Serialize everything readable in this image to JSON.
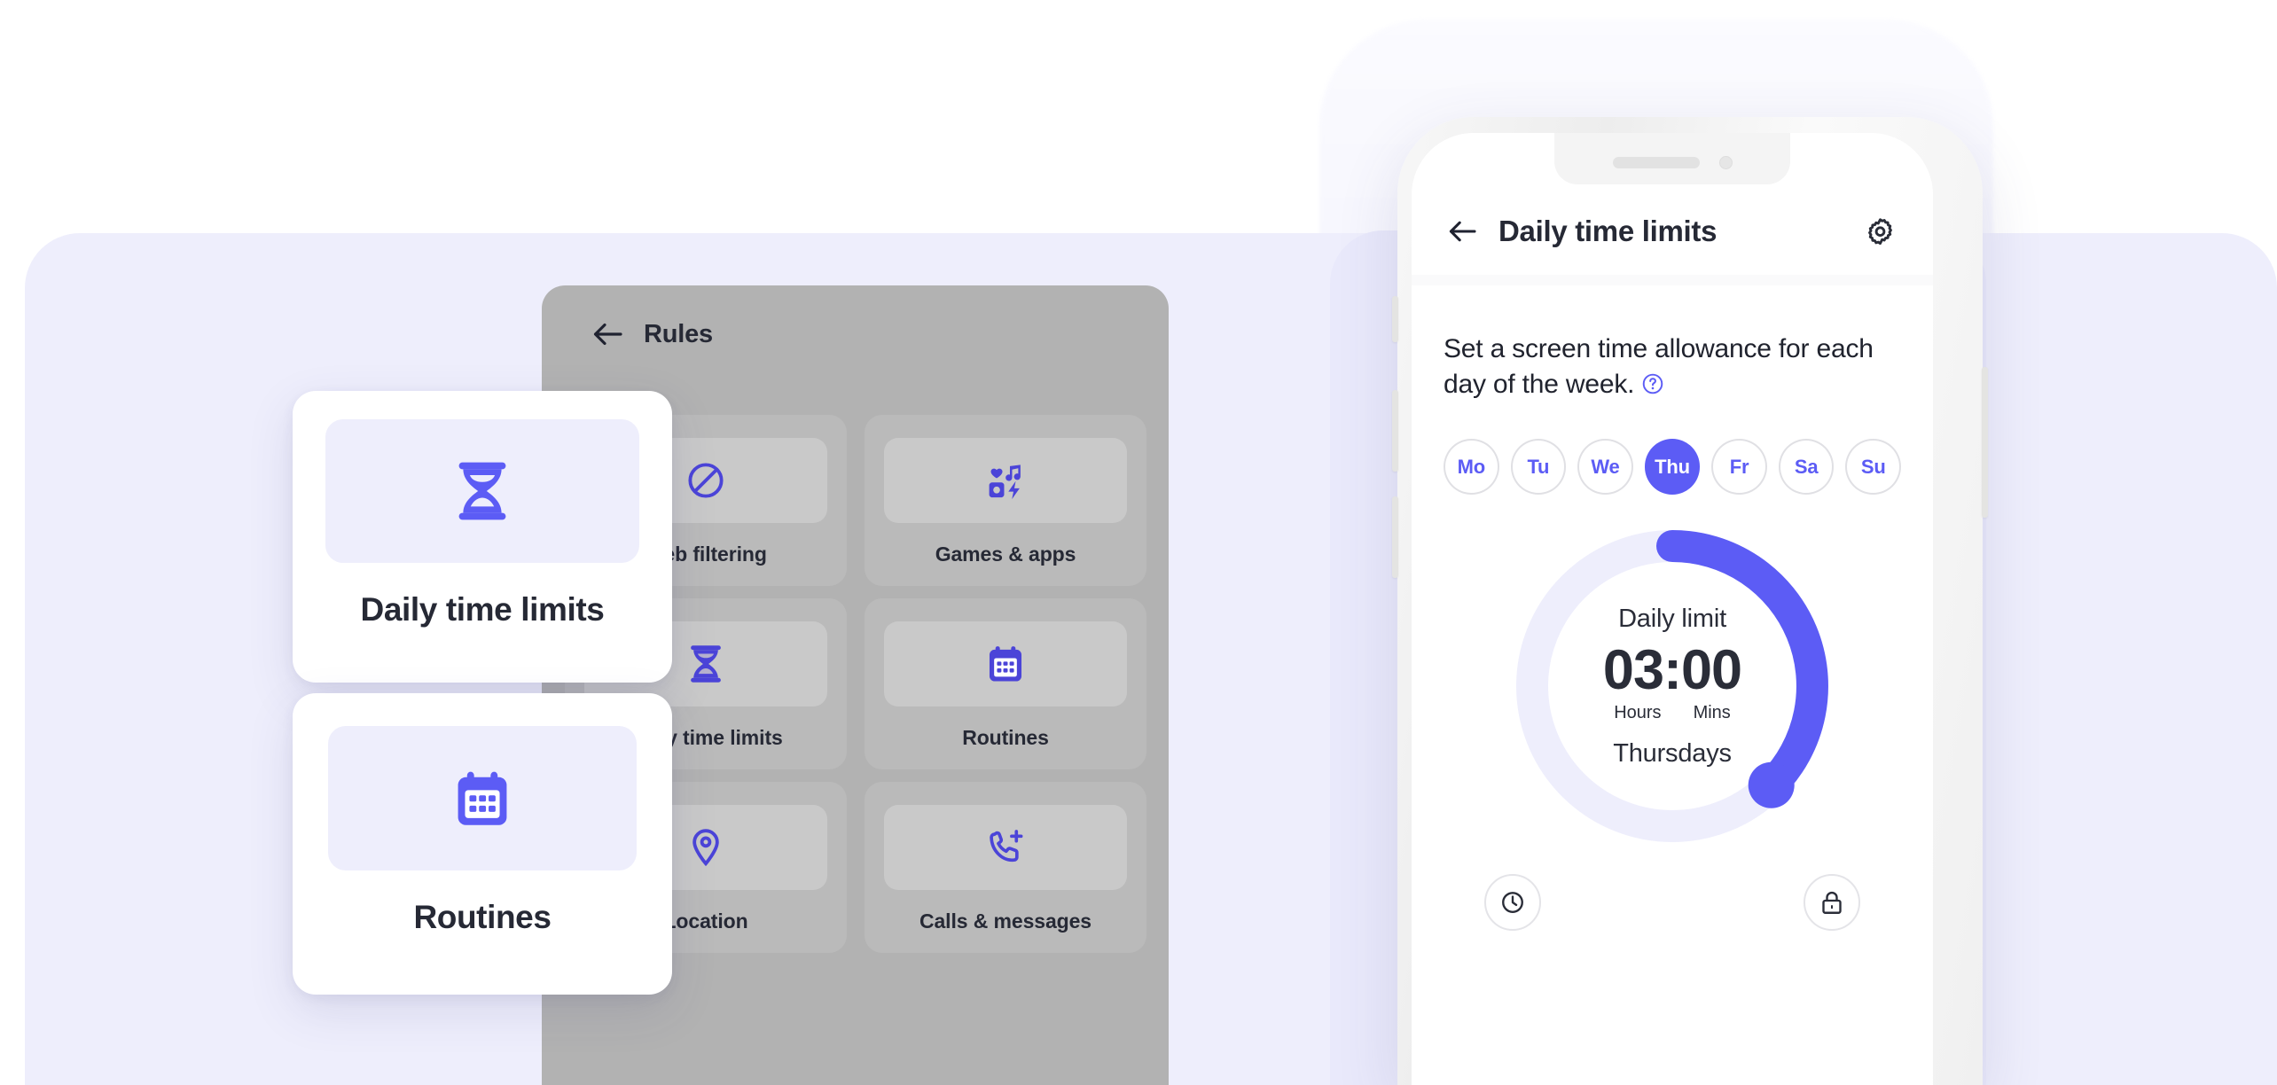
{
  "theme": {
    "accent": "#5c5cf5",
    "accent_light": "#eeeefc",
    "text_dark": "#262935",
    "panel_bg": "#eeeefc",
    "dim_overlay": "#b2b2b2"
  },
  "rules_panel": {
    "title": "Rules",
    "back_icon": "arrow-left-icon",
    "tiles": [
      {
        "label": "Web filtering",
        "icon": "no-entry-icon"
      },
      {
        "label": "Games & apps",
        "icon": "games-apps-icon"
      },
      {
        "label": "Daily time limits",
        "icon": "hourglass-icon"
      },
      {
        "label": "Routines",
        "icon": "calendar-icon"
      },
      {
        "label": "Location",
        "icon": "map-pin-icon"
      },
      {
        "label": "Calls & messages",
        "icon": "phone-plus-icon"
      }
    ]
  },
  "feature_cards": [
    {
      "label": "Daily time limits",
      "icon": "hourglass-icon"
    },
    {
      "label": "Routines",
      "icon": "calendar-icon"
    }
  ],
  "phone": {
    "header": {
      "back_icon": "arrow-left-icon",
      "title": "Daily time limits",
      "settings_icon": "gear-icon"
    },
    "intro": "Set a screen time allowance for each day of the week.",
    "help_icon": "question-circle-icon",
    "days": [
      {
        "label": "Mo",
        "selected": false
      },
      {
        "label": "Tu",
        "selected": false
      },
      {
        "label": "We",
        "selected": false
      },
      {
        "label": "Thu",
        "selected": true
      },
      {
        "label": "Fr",
        "selected": false
      },
      {
        "label": "Sa",
        "selected": false
      },
      {
        "label": "Su",
        "selected": false
      }
    ],
    "dial": {
      "title": "Daily limit",
      "value": "03:00",
      "unit_hours": "Hours",
      "unit_mins": "Mins",
      "day_label": "Thursdays",
      "progress_percent": 35,
      "track_color": "#eeeefc",
      "arc_color": "#5c5cf5"
    },
    "bottom_buttons": [
      {
        "icon": "clock-icon"
      },
      {
        "icon": "lock-icon"
      }
    ]
  }
}
